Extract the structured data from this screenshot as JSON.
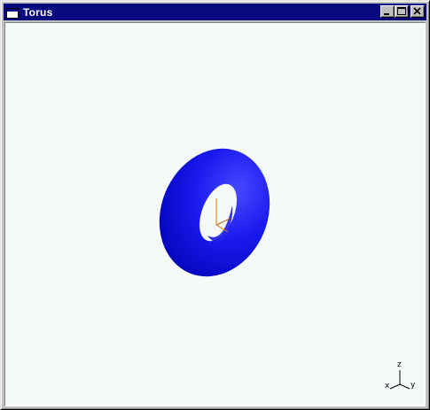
{
  "window": {
    "title": "Torus",
    "buttons": {
      "minimize": "minimize-icon",
      "maximize": "maximize-icon",
      "close": "close-icon"
    }
  },
  "viewport": {
    "background": "#f5faf8",
    "object": {
      "shape": "torus",
      "color": "#1515e8",
      "shade_dark": "#0000a0",
      "shade_light": "#4a4aff",
      "origin_axes_color": "#e07800"
    },
    "triad": {
      "x_label": "x",
      "y_label": "y",
      "z_label": "z"
    }
  }
}
